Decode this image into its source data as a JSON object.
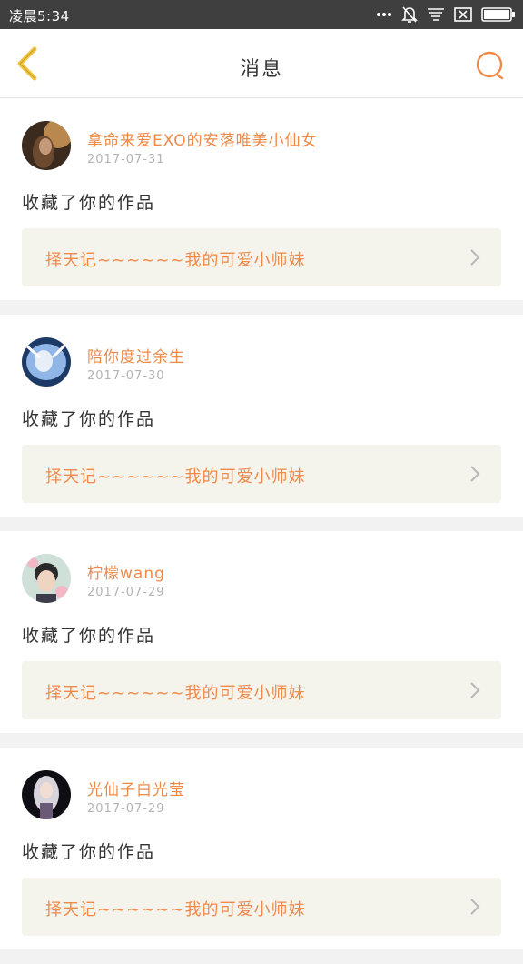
{
  "status_bar": {
    "time": "凌晨5:34",
    "icons": [
      "dots-icon",
      "bell-off-icon",
      "notification-list-icon",
      "sim-blocked-icon",
      "battery-icon"
    ]
  },
  "header": {
    "title": "消息",
    "back_icon": "back-chevron-icon",
    "search_icon": "search-icon"
  },
  "colors": {
    "accent": "#ef8a4a",
    "back_icon": "#f0c43c",
    "card_link_bg": "#f4f3ec",
    "page_bg": "#f2f2f2"
  },
  "messages": [
    {
      "username": "拿命来爱EXO的安落唯美小仙女",
      "date": "2017-07-31",
      "action": "收藏了你的作品",
      "work_title": "择天记~~~~~~我的可爱小师妹"
    },
    {
      "username": "陪你度过余生",
      "date": "2017-07-30",
      "action": "收藏了你的作品",
      "work_title": "择天记~~~~~~我的可爱小师妹"
    },
    {
      "username": "柠檬wang",
      "date": "2017-07-29",
      "action": "收藏了你的作品",
      "work_title": "择天记~~~~~~我的可爱小师妹"
    },
    {
      "username": "光仙子白光莹",
      "date": "2017-07-29",
      "action": "收藏了你的作品",
      "work_title": "择天记~~~~~~我的可爱小师妹"
    }
  ]
}
